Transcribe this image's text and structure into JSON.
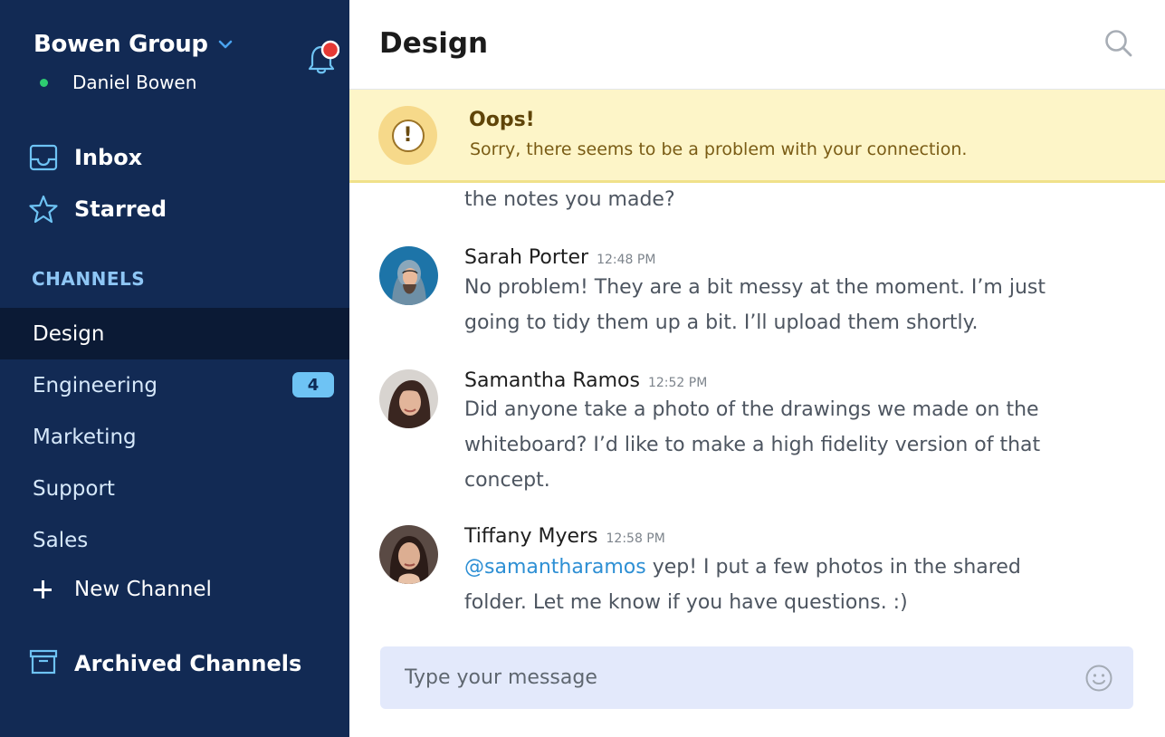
{
  "sidebar": {
    "team_name": "Bowen Group",
    "user_name": "Daniel Bowen",
    "user_status_color": "#2ecc71",
    "notification_dot_color": "#e53935",
    "nav": {
      "inbox": "Inbox",
      "starred": "Starred"
    },
    "channels_label": "CHANNELS",
    "channels": [
      {
        "name": "Design",
        "active": true
      },
      {
        "name": "Engineering",
        "badge": "4"
      },
      {
        "name": "Marketing"
      },
      {
        "name": "Support"
      },
      {
        "name": "Sales"
      }
    ],
    "new_channel": "New Channel",
    "archived_channels": "Archived Channels"
  },
  "main": {
    "title": "Design",
    "alert": {
      "title": "Oops!",
      "message": "Sorry, there seems to be a problem with your connection.",
      "icon_glyph": "!"
    },
    "partial_message": "the notes you made?",
    "messages": [
      {
        "author": "Sarah Porter",
        "time": "12:48 PM",
        "text": "No problem! They are a bit messy at the moment. I’m just going to tidy them up a bit. I’ll upload them shortly."
      },
      {
        "author": "Samantha Ramos",
        "time": "12:52 PM",
        "text": "Did anyone take a photo of the drawings we made on the whiteboard? I’d like to make a high fidelity version of that concept."
      },
      {
        "author": "Tiffany Myers",
        "time": "12:58 PM",
        "mention": "@samantharamos",
        "text": " yep! I put a few photos in the shared folder. Let me know if you have questions. :)"
      }
    ],
    "composer": {
      "placeholder": "Type your message"
    }
  },
  "colors": {
    "sidebar_bg": "#122a54",
    "active_channel_bg": "#0b1a35",
    "badge_bg": "#6ec3f4",
    "alert_bg": "#fdf5c8",
    "composer_bg": "#e3e9fb",
    "mention": "#2d8fd4"
  }
}
